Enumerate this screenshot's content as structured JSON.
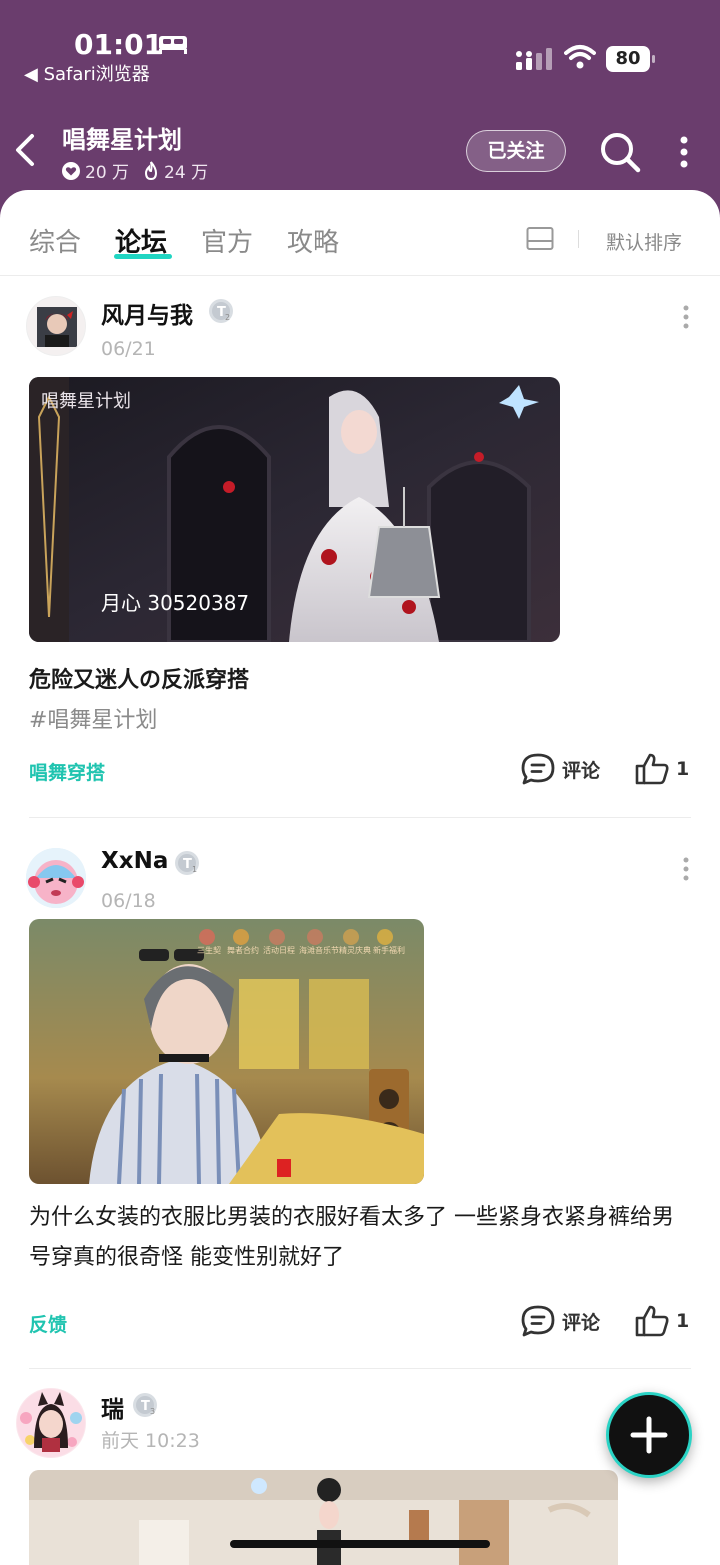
{
  "status_bar": {
    "time": "01:01",
    "back_app": "◀ Safari浏览器",
    "battery": "80"
  },
  "header": {
    "title": "唱舞星计划",
    "likes": "20 万",
    "heat": "24 万",
    "follow_label": "已关注"
  },
  "tabs": [
    {
      "label": "综合",
      "active": false
    },
    {
      "label": "论坛",
      "active": true
    },
    {
      "label": "官方",
      "active": false
    },
    {
      "label": "攻略",
      "active": false
    }
  ],
  "sort_label": "默认排序",
  "posts": [
    {
      "username": "风月与我",
      "level": "2",
      "date": "06/21",
      "image_caption": "月心 30520387",
      "image_logo": "唱舞星计划",
      "title": "危险又迷人の反派穿搭",
      "hashtag": "#唱舞星计划",
      "category": "唱舞穿搭",
      "comment_label": "评论",
      "likes": "1"
    },
    {
      "username": "XxNa",
      "level": "1",
      "date": "06/18",
      "image_menu": [
        "三生契",
        "舞者合约",
        "活动日程",
        "海滩音乐节",
        "精灵庆典",
        "新手福利"
      ],
      "body": "为什么女装的衣服比男装的衣服好看太多了 一些紧身衣紧身裤给男号穿真的很奇怪 能变性别就好了",
      "category": "反馈",
      "comment_label": "评论",
      "likes": "1"
    },
    {
      "username": "瑞",
      "level": "3",
      "date": "前天 10:23"
    }
  ],
  "colors": {
    "header_bg": "#6a3d6d",
    "accent": "#20d5c2",
    "category": "#20c4b0"
  }
}
